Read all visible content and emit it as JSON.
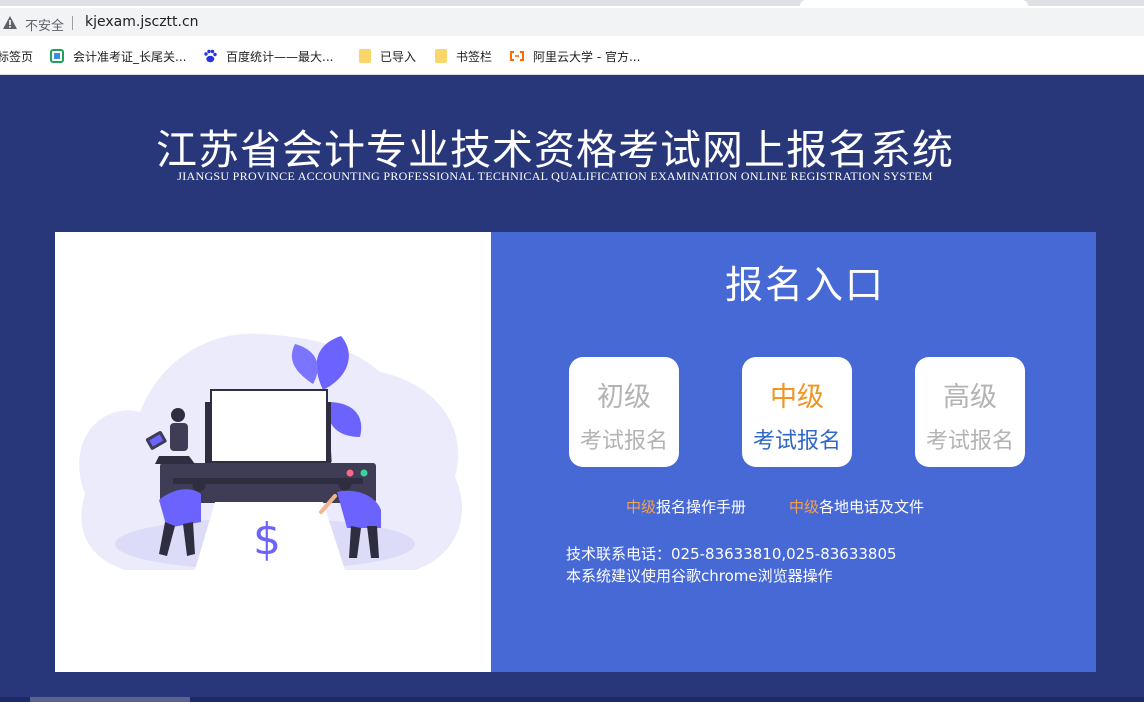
{
  "browser": {
    "security_label": "不安全",
    "url": "kjexam.jscztt.cn",
    "bookmarks": [
      {
        "label": "标签页",
        "icon": "apps-icon"
      },
      {
        "label": "会计准考证_长尾关...",
        "icon": "site-favicon"
      },
      {
        "label": "百度统计——最大...",
        "icon": "baidu-paw-icon"
      },
      {
        "label": "已导入",
        "icon": "folder-icon"
      },
      {
        "label": "书签栏",
        "icon": "folder-icon"
      },
      {
        "label": "阿里云大学 - 官方...",
        "icon": "aliyun-icon"
      }
    ]
  },
  "header": {
    "title": "江苏省会计专业技术资格考试网上报名系统",
    "subtitle": "JIANGSU PROVINCE ACCOUNTING PROFESSIONAL TECHNICAL QUALIFICATION EXAMINATION ONLINE REGISTRATION SYSTEM"
  },
  "registration": {
    "heading": "报名入口",
    "levels": [
      {
        "level": "初级",
        "action": "考试报名",
        "active": false
      },
      {
        "level": "中级",
        "action": "考试报名",
        "active": true
      },
      {
        "level": "高级",
        "action": "考试报名",
        "active": false
      }
    ],
    "links": [
      {
        "highlight": "中级",
        "text": "报名操作手册"
      },
      {
        "highlight": "中级",
        "text": "各地电话及文件"
      }
    ],
    "contact_phone": "技术联系电话：025-83633810,025-83633805",
    "browser_tip": "本系统建议使用谷歌chrome浏览器操作"
  },
  "illustration": {
    "symbol": "$"
  },
  "colors": {
    "page_bg": "#28367a",
    "panel_blue": "#4769d6",
    "active_level": "#f29422",
    "active_action": "#2f68c9",
    "inactive_text": "#b3b3b3",
    "link_highlight": "#f6a04a"
  }
}
